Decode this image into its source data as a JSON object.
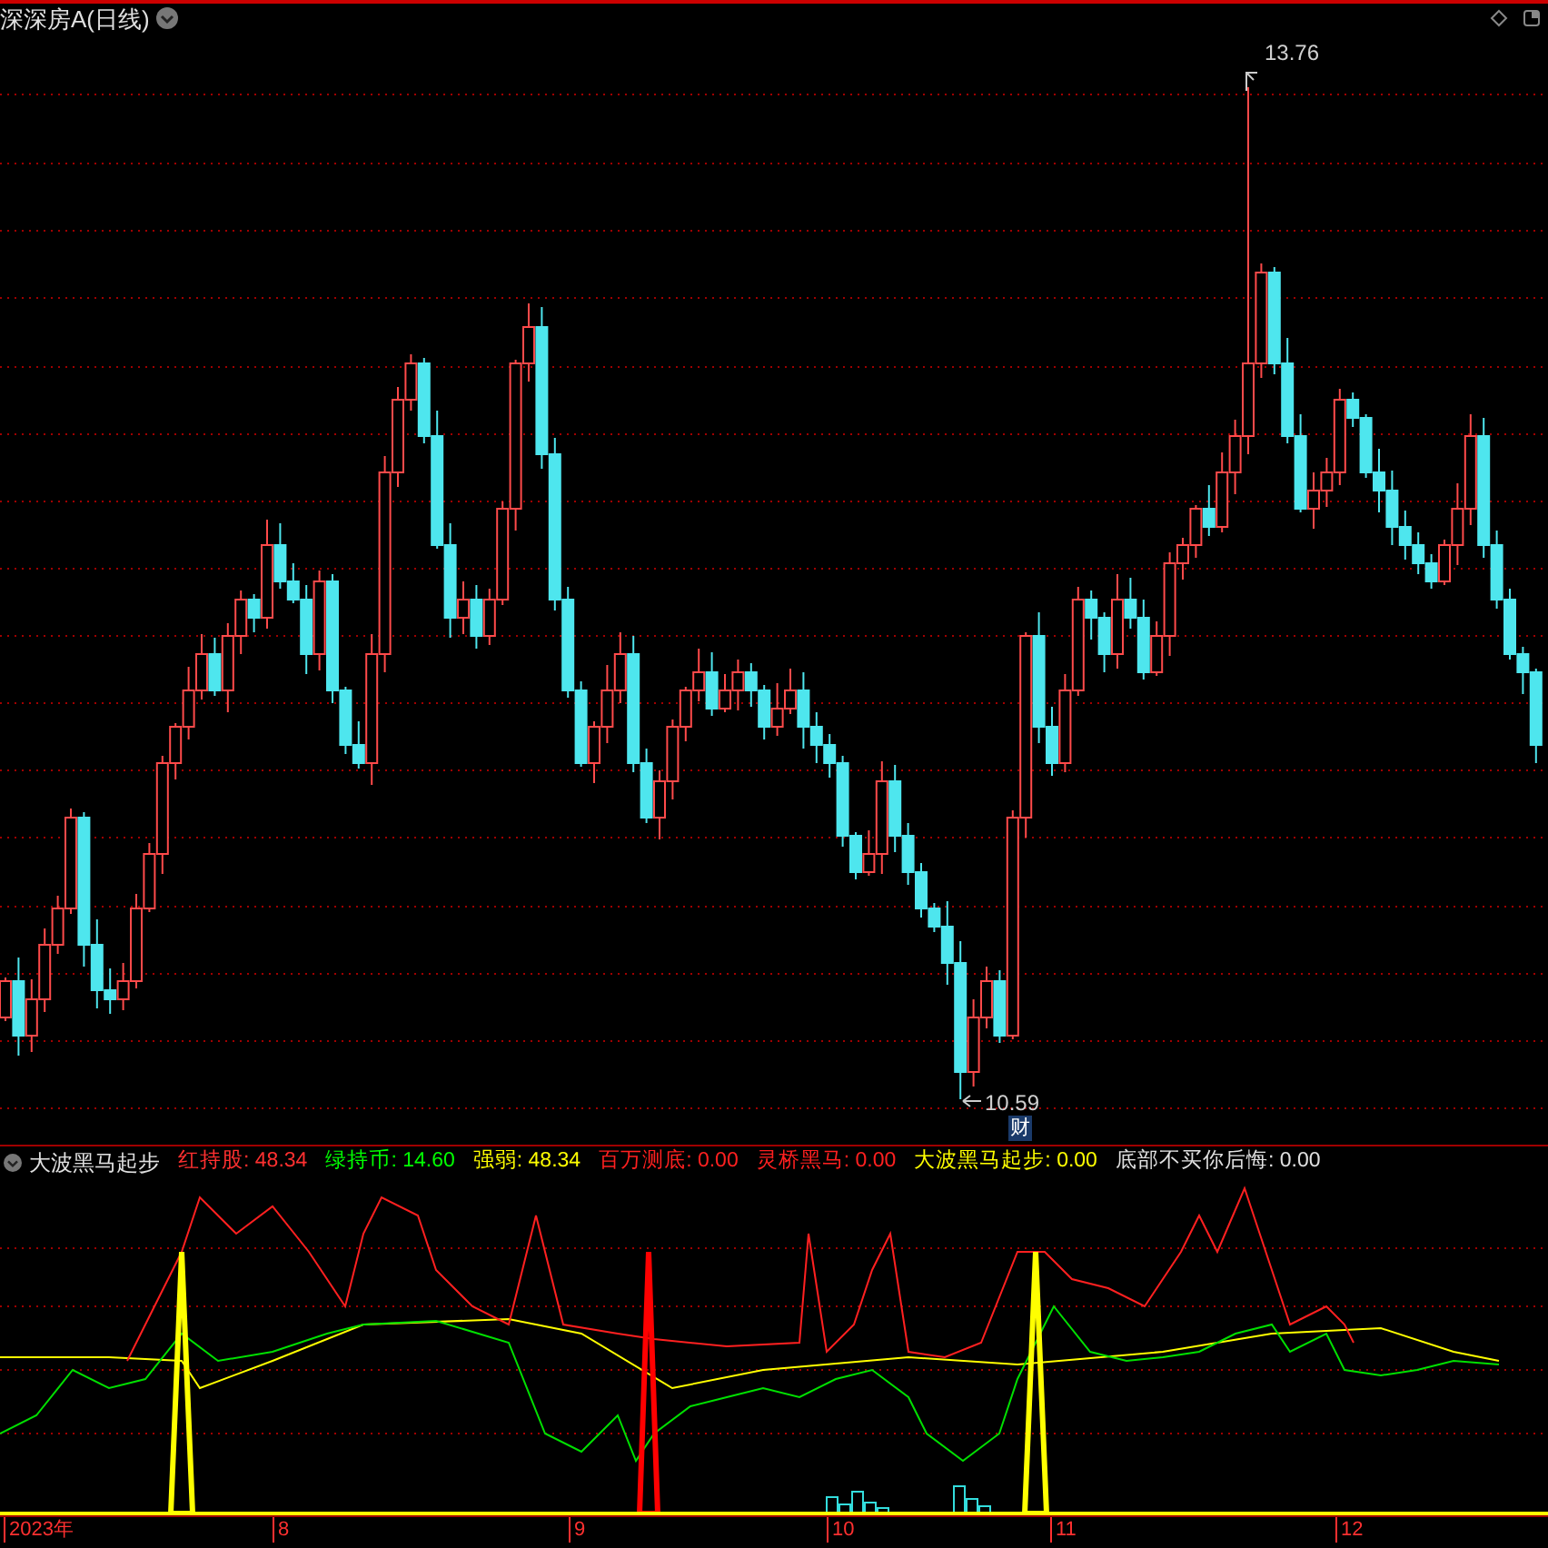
{
  "header": {
    "title": "深深房A(日线)"
  },
  "price_chart": {
    "high_label": "13.76",
    "low_label": "10.59",
    "event_badge": "财"
  },
  "indicator": {
    "name": "大波黑马起步",
    "readings": [
      {
        "label": "红持股:",
        "value": "48.34",
        "color": "#ff3030"
      },
      {
        "label": "绿持币:",
        "value": "14.60",
        "color": "#00ff00"
      },
      {
        "label": "强弱:",
        "value": "48.34",
        "color": "#ffff00"
      },
      {
        "label": "百万测底:",
        "value": "0.00",
        "color": "#ff2020"
      },
      {
        "label": "灵桥黑马:",
        "value": "0.00",
        "color": "#ff2020"
      },
      {
        "label": "大波黑马起步:",
        "value": "0.00",
        "color": "#ffff00"
      },
      {
        "label": "底部不买你后悔:",
        "value": "0.00",
        "color": "#e0e0e0"
      }
    ]
  },
  "time_axis": {
    "labels": [
      "2023年",
      "8",
      "9",
      "10",
      "11",
      "12"
    ]
  }
}
